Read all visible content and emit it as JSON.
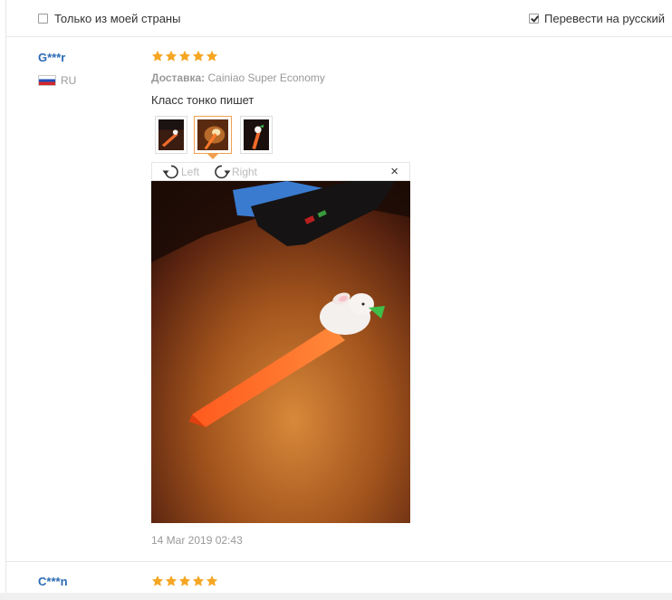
{
  "filters": {
    "own_country_label": "Только из моей страны",
    "own_country_checked": false,
    "translate_label": "Перевести на русский",
    "translate_checked": true
  },
  "reviews": [
    {
      "author": "G***r",
      "country": "RU",
      "rating": 5,
      "delivery_label": "Доставка:",
      "delivery_value": "Cainiao Super Economy",
      "text": "Класс тонко пишет",
      "thumbnails": [
        "photo-1",
        "photo-2",
        "photo-3"
      ],
      "active_thumbnail": 1,
      "viewer": {
        "rotate_left_label": "Left",
        "rotate_right_label": "Right",
        "close_label": "×"
      },
      "date": "14 Mar 2019 02:43"
    },
    {
      "author": "C***n",
      "rating": 5
    }
  ],
  "colors": {
    "author": "#2a6ab4",
    "star": "#f5a623",
    "active_thumb_border": "#f0a050"
  }
}
